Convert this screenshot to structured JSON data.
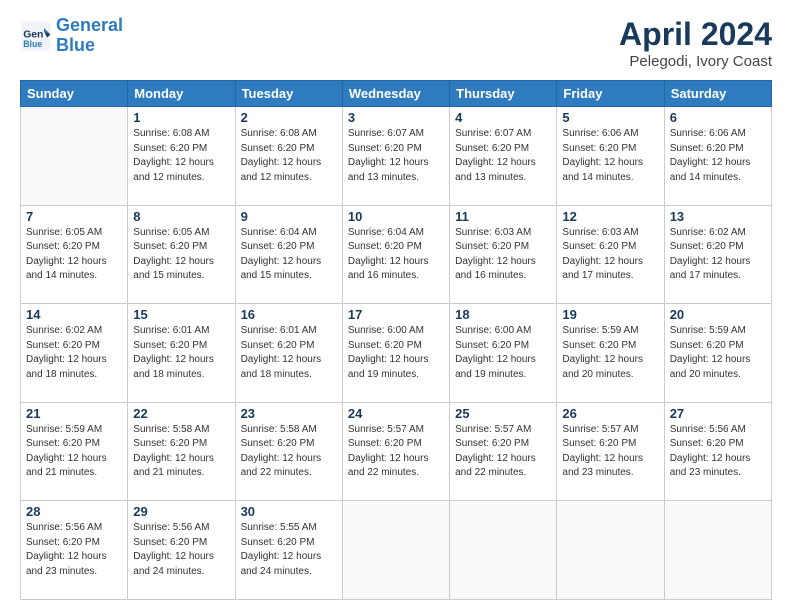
{
  "header": {
    "logo_line1": "General",
    "logo_line2": "Blue",
    "month": "April 2024",
    "location": "Pelegodi, Ivory Coast"
  },
  "weekdays": [
    "Sunday",
    "Monday",
    "Tuesday",
    "Wednesday",
    "Thursday",
    "Friday",
    "Saturday"
  ],
  "weeks": [
    [
      {
        "day": "",
        "info": ""
      },
      {
        "day": "1",
        "info": "Sunrise: 6:08 AM\nSunset: 6:20 PM\nDaylight: 12 hours\nand 12 minutes."
      },
      {
        "day": "2",
        "info": "Sunrise: 6:08 AM\nSunset: 6:20 PM\nDaylight: 12 hours\nand 12 minutes."
      },
      {
        "day": "3",
        "info": "Sunrise: 6:07 AM\nSunset: 6:20 PM\nDaylight: 12 hours\nand 13 minutes."
      },
      {
        "day": "4",
        "info": "Sunrise: 6:07 AM\nSunset: 6:20 PM\nDaylight: 12 hours\nand 13 minutes."
      },
      {
        "day": "5",
        "info": "Sunrise: 6:06 AM\nSunset: 6:20 PM\nDaylight: 12 hours\nand 14 minutes."
      },
      {
        "day": "6",
        "info": "Sunrise: 6:06 AM\nSunset: 6:20 PM\nDaylight: 12 hours\nand 14 minutes."
      }
    ],
    [
      {
        "day": "7",
        "info": "Sunrise: 6:05 AM\nSunset: 6:20 PM\nDaylight: 12 hours\nand 14 minutes."
      },
      {
        "day": "8",
        "info": "Sunrise: 6:05 AM\nSunset: 6:20 PM\nDaylight: 12 hours\nand 15 minutes."
      },
      {
        "day": "9",
        "info": "Sunrise: 6:04 AM\nSunset: 6:20 PM\nDaylight: 12 hours\nand 15 minutes."
      },
      {
        "day": "10",
        "info": "Sunrise: 6:04 AM\nSunset: 6:20 PM\nDaylight: 12 hours\nand 16 minutes."
      },
      {
        "day": "11",
        "info": "Sunrise: 6:03 AM\nSunset: 6:20 PM\nDaylight: 12 hours\nand 16 minutes."
      },
      {
        "day": "12",
        "info": "Sunrise: 6:03 AM\nSunset: 6:20 PM\nDaylight: 12 hours\nand 17 minutes."
      },
      {
        "day": "13",
        "info": "Sunrise: 6:02 AM\nSunset: 6:20 PM\nDaylight: 12 hours\nand 17 minutes."
      }
    ],
    [
      {
        "day": "14",
        "info": "Sunrise: 6:02 AM\nSunset: 6:20 PM\nDaylight: 12 hours\nand 18 minutes."
      },
      {
        "day": "15",
        "info": "Sunrise: 6:01 AM\nSunset: 6:20 PM\nDaylight: 12 hours\nand 18 minutes."
      },
      {
        "day": "16",
        "info": "Sunrise: 6:01 AM\nSunset: 6:20 PM\nDaylight: 12 hours\nand 18 minutes."
      },
      {
        "day": "17",
        "info": "Sunrise: 6:00 AM\nSunset: 6:20 PM\nDaylight: 12 hours\nand 19 minutes."
      },
      {
        "day": "18",
        "info": "Sunrise: 6:00 AM\nSunset: 6:20 PM\nDaylight: 12 hours\nand 19 minutes."
      },
      {
        "day": "19",
        "info": "Sunrise: 5:59 AM\nSunset: 6:20 PM\nDaylight: 12 hours\nand 20 minutes."
      },
      {
        "day": "20",
        "info": "Sunrise: 5:59 AM\nSunset: 6:20 PM\nDaylight: 12 hours\nand 20 minutes."
      }
    ],
    [
      {
        "day": "21",
        "info": "Sunrise: 5:59 AM\nSunset: 6:20 PM\nDaylight: 12 hours\nand 21 minutes."
      },
      {
        "day": "22",
        "info": "Sunrise: 5:58 AM\nSunset: 6:20 PM\nDaylight: 12 hours\nand 21 minutes."
      },
      {
        "day": "23",
        "info": "Sunrise: 5:58 AM\nSunset: 6:20 PM\nDaylight: 12 hours\nand 22 minutes."
      },
      {
        "day": "24",
        "info": "Sunrise: 5:57 AM\nSunset: 6:20 PM\nDaylight: 12 hours\nand 22 minutes."
      },
      {
        "day": "25",
        "info": "Sunrise: 5:57 AM\nSunset: 6:20 PM\nDaylight: 12 hours\nand 22 minutes."
      },
      {
        "day": "26",
        "info": "Sunrise: 5:57 AM\nSunset: 6:20 PM\nDaylight: 12 hours\nand 23 minutes."
      },
      {
        "day": "27",
        "info": "Sunrise: 5:56 AM\nSunset: 6:20 PM\nDaylight: 12 hours\nand 23 minutes."
      }
    ],
    [
      {
        "day": "28",
        "info": "Sunrise: 5:56 AM\nSunset: 6:20 PM\nDaylight: 12 hours\nand 23 minutes."
      },
      {
        "day": "29",
        "info": "Sunrise: 5:56 AM\nSunset: 6:20 PM\nDaylight: 12 hours\nand 24 minutes."
      },
      {
        "day": "30",
        "info": "Sunrise: 5:55 AM\nSunset: 6:20 PM\nDaylight: 12 hours\nand 24 minutes."
      },
      {
        "day": "",
        "info": ""
      },
      {
        "day": "",
        "info": ""
      },
      {
        "day": "",
        "info": ""
      },
      {
        "day": "",
        "info": ""
      }
    ]
  ]
}
